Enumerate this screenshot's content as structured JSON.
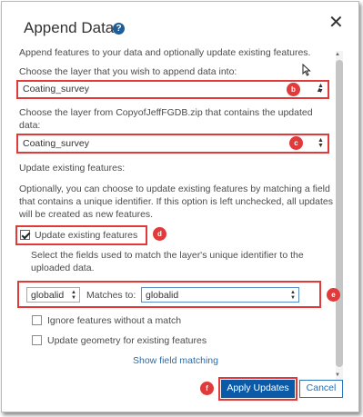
{
  "dialog": {
    "title": "Append Data",
    "help_icon": "?",
    "close_icon": "✕"
  },
  "intro": "Append features to your data and optionally update existing features.",
  "target_layer": {
    "label": "Choose the layer that you wish to append data into:",
    "value": "Coating_survey",
    "badge": "b"
  },
  "source_layer": {
    "label_line1": "Choose the layer from CopyofJeffFGDB.zip that contains the updated",
    "label_line2": "data:",
    "value": "Coating_survey",
    "badge": "c"
  },
  "update_section": {
    "heading": "Update existing features:",
    "desc_line1": "Optionally, you can choose to update existing features by matching a field",
    "desc_line2": "that contains a unique identifier. If this option is left unchecked, all updates",
    "desc_line3": "will be created as new features."
  },
  "update_checkbox": {
    "label": "Update existing features",
    "checked": true,
    "badge": "d"
  },
  "match_fields": {
    "desc_line1": "Select the fields used to match the layer's unique identifier to the",
    "desc_line2": "uploaded data.",
    "left_value": "globalid",
    "matches_label": "Matches to:",
    "right_value": "globalid",
    "badge": "e"
  },
  "options": {
    "ignore_label": "Ignore features without a match",
    "geometry_label": "Update geometry for existing features"
  },
  "show_field_matching": "Show field matching",
  "buttons": {
    "apply": "Apply Updates",
    "cancel": "Cancel",
    "apply_badge": "f"
  },
  "colors": {
    "accent": "#0a5aa8",
    "annotation_red": "#e03a3a",
    "link": "#1f6fb5"
  }
}
